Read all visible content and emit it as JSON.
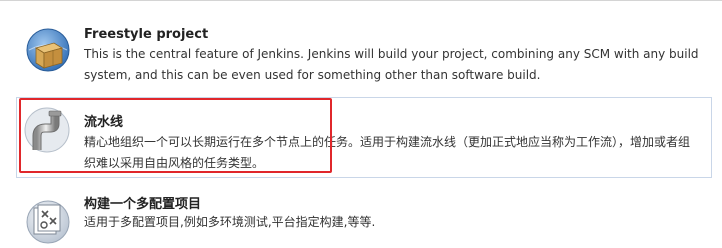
{
  "job_types": [
    {
      "title": "Freestyle project",
      "description": "This is the central feature of Jenkins. Jenkins will build your project, combining any SCM with any build system, and this can be even used for something other than software build.",
      "icon": "freestyle-box-icon"
    },
    {
      "title": "流水线",
      "description": "精心地组织一个可以长期运行在多个节点上的任务。适用于构建流水线（更加正式地应当称为工作流），增加或者组织难以采用自由风格的任务类型。",
      "icon": "pipeline-icon"
    },
    {
      "title": "构建一个多配置项目",
      "description": "适用于多配置项目,例如多环境测试,平台指定构建,等等.",
      "icon": "multi-config-icon"
    }
  ],
  "colors": {
    "highlight": "#e0272b",
    "selected_border": "#c9d6e8"
  }
}
